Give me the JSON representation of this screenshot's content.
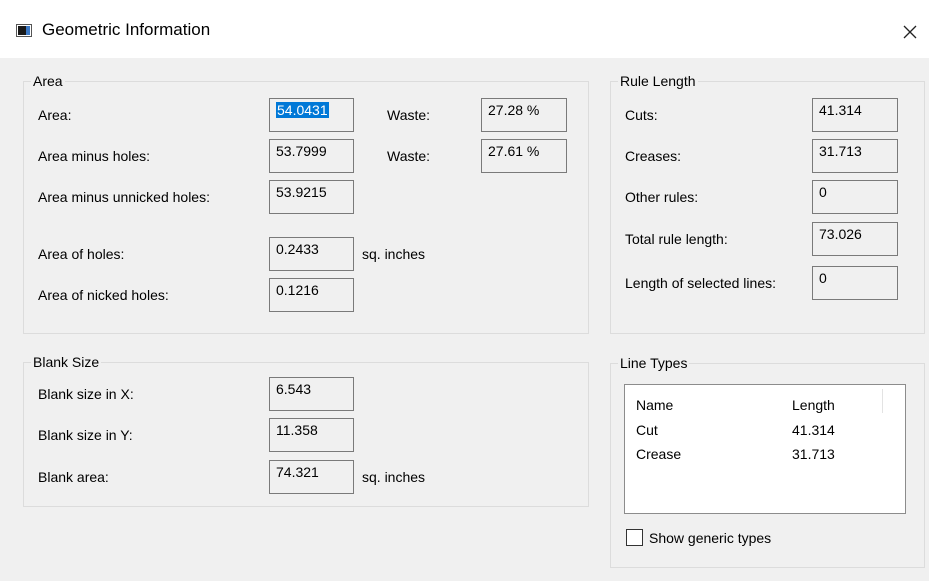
{
  "window": {
    "title": "Geometric Information",
    "icon": "dialog-app-icon",
    "close_icon": "close-icon"
  },
  "area_group": {
    "label": "Area",
    "area_label": "Area:",
    "area_value": "54.0431",
    "waste1_label": "Waste:",
    "waste1_value": "27.28 %",
    "minus_holes_label": "Area minus holes:",
    "minus_holes_value": "53.7999",
    "waste2_label": "Waste:",
    "waste2_value": "27.61 %",
    "minus_unnicked_label": "Area minus unnicked holes:",
    "minus_unnicked_value": "53.9215",
    "holes_label": "Area of holes:",
    "holes_value": "0.2433",
    "holes_unit": "sq. inches",
    "nicked_label": "Area of nicked holes:",
    "nicked_value": "0.1216"
  },
  "blank_group": {
    "label": "Blank Size",
    "x_label": "Blank size in X:",
    "x_value": "6.543",
    "y_label": "Blank size in Y:",
    "y_value": "11.358",
    "area_label": "Blank area:",
    "area_value": "74.321",
    "area_unit": "sq. inches"
  },
  "rule_group": {
    "label": "Rule Length",
    "cuts_label": "Cuts:",
    "cuts_value": "41.314",
    "creases_label": "Creases:",
    "creases_value": "31.713",
    "other_label": "Other rules:",
    "other_value": "0",
    "total_label": "Total rule length:",
    "total_value": "73.026",
    "selected_label": "Length of selected lines:",
    "selected_value": "0"
  },
  "line_types": {
    "label": "Line Types",
    "columns": [
      "Name",
      "Length"
    ],
    "rows": [
      {
        "name": "Cut",
        "length": "41.314"
      },
      {
        "name": "Crease",
        "length": "31.713"
      }
    ],
    "checkbox_label": "Show generic types",
    "checkbox_checked": false
  }
}
